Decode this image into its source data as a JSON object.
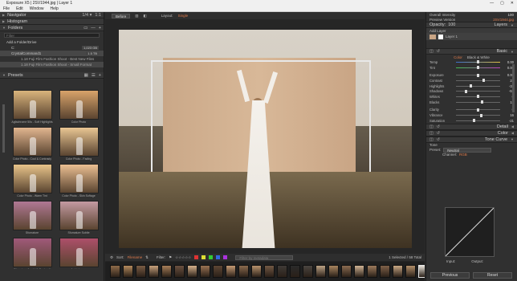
{
  "window": {
    "title": "Exposure X5 | 2SV1944.jpg | Layer 1",
    "controls": [
      "—",
      "▢",
      "✕"
    ]
  },
  "menu": [
    "File",
    "Edit",
    "Window",
    "Help"
  ],
  "left": {
    "navigator": {
      "label": "Navigator",
      "zoom": "1/4 ▾",
      "fit": "1:1"
    },
    "histogram": "Histogram",
    "folders": {
      "label": "Folders",
      "filter_placeholder": "Filter",
      "add_drive": "Add a Folder/Drive",
      "rows": [
        {
          "label": "C:",
          "count": "1,023 GB"
        },
        {
          "label": "CrystalCommand1",
          "count": "1.5 TB"
        },
        {
          "label": "1.18 Fuji Film Fashion Shoot - Best New Files"
        },
        {
          "label": "1.18 Fuji Film Fashion Shoot - Small Format"
        }
      ]
    },
    "presets": {
      "label": "Presets",
      "items": [
        {
          "label": "Agfachrome 50s - Soft Highlights",
          "color": "#d9b47c"
        },
        {
          "label": "Color Photo",
          "color": "#d9a36a"
        },
        {
          "label": "Color Photo - Cool & Contrasty",
          "color": "#e2b690"
        },
        {
          "label": "Color Photo - Fading",
          "color": "#e9c693"
        },
        {
          "label": "Color Photo - Warm Tint",
          "color": "#e8c48a"
        },
        {
          "label": "Color Photo - Skin Softage",
          "color": "#ebbf92"
        },
        {
          "label": "Sfumature",
          "color": "#b07894"
        },
        {
          "label": "Sfumature Subtle",
          "color": "#c49aa2"
        },
        {
          "label": "Sfumature (Lo_ht & Contrast)",
          "color": "#a0597a"
        },
        {
          "label": "Arabichrome",
          "color": "#ad4f6a"
        }
      ]
    }
  },
  "center": {
    "before_label": "Before",
    "layout_label": "Layout:",
    "layout_value": "Single",
    "bottom": {
      "sort_label": "Sort:",
      "sort_value": "Filename",
      "filter_label": "Filter:",
      "search_placeholder": "Filter by metadata",
      "status": "1 Selected / 58 Total"
    },
    "filmstrip_colors": [
      "#8e6b4a",
      "#b58a5e",
      "#7a5c44",
      "#c7a17c",
      "#a77e58",
      "#6b5140",
      "#d4b08a",
      "#9a7353",
      "#5d4634",
      "#c49a73",
      "#8a6a4e",
      "#b8926c",
      "#735944",
      "#3f3a36",
      "#2a2a2a",
      "#4a4540",
      "#bca284",
      "#a8845f",
      "#8b6c51",
      "#d0b394",
      "#9c7a5c",
      "#7f6149",
      "#c9a884",
      "#b18d69",
      "#e6e1d8",
      "#a27e5f",
      "#8c6d52",
      "#6e5744"
    ]
  },
  "right": {
    "top_rows": [
      {
        "label": "Overall Intensity",
        "value": "100"
      },
      {
        "label": "Preview Version",
        "value": "2SV1944.jpg"
      }
    ],
    "layers": {
      "opacity_label": "Opacity:",
      "opacity_value": "100",
      "title": "Layers",
      "add_layer": "Add Layer",
      "layer_name": "Layer 1"
    },
    "basic": {
      "title": "Basic",
      "color_label": "Color",
      "bw_label": "Black & White",
      "sliders": [
        {
          "name": "Temp",
          "value": "0.00",
          "pos": 0.5
        },
        {
          "name": "Tint",
          "value": "0.00",
          "pos": 0.5
        },
        {
          "name": "Exposure",
          "value": "0.00",
          "pos": 0.5
        },
        {
          "name": "Contrast",
          "value": "23",
          "pos": 0.62
        },
        {
          "name": "Highlights",
          "value": "-32",
          "pos": 0.34
        },
        {
          "name": "Shadows",
          "value": "-57",
          "pos": 0.22
        },
        {
          "name": "Whites",
          "value": "0",
          "pos": 0.5
        },
        {
          "name": "Blacks",
          "value": "18",
          "pos": 0.59
        },
        {
          "name": "Clarity",
          "value": "0",
          "pos": 0.5
        },
        {
          "name": "Vibrance",
          "value": "16",
          "pos": 0.58
        },
        {
          "name": "Saturation",
          "value": "-21",
          "pos": 0.4
        }
      ]
    },
    "detail": "Detail",
    "color": "Color",
    "tone_curve": {
      "title": "Tone Curve",
      "tone_label": "Tone",
      "preset_label": "Preset:",
      "preset_value": "Neutral",
      "channel_label": "Channel:",
      "channel_value": "RGB",
      "input_label": "Input:",
      "output_label": "Output:"
    },
    "previous": "Previous",
    "reset": "Reset"
  }
}
